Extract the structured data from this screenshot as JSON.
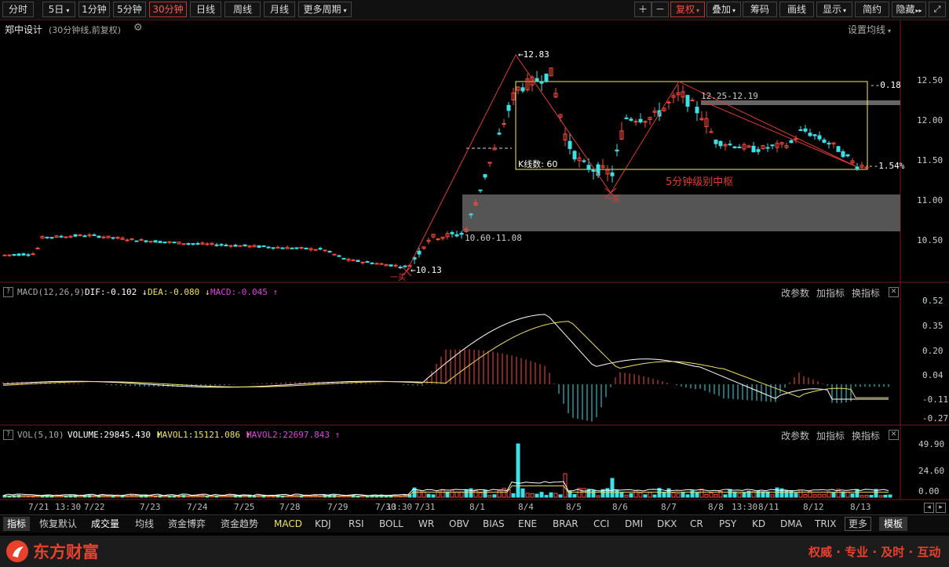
{
  "toolbar_left": [
    {
      "label": "分时",
      "active": false
    },
    {
      "label": "5日",
      "caret": true,
      "active": false
    },
    {
      "label": "1分钟",
      "active": false
    },
    {
      "label": "5分钟",
      "active": false
    },
    {
      "label": "30分钟",
      "active": true
    },
    {
      "label": "日线",
      "active": false
    },
    {
      "label": "周线",
      "active": false
    },
    {
      "label": "月线",
      "active": false
    },
    {
      "label": "更多周期",
      "caret": true,
      "active": false
    }
  ],
  "toolbar_right": [
    {
      "label": "＋"
    },
    {
      "label": "－"
    },
    {
      "label": "复权",
      "caret": true
    },
    {
      "label": "叠加",
      "caret": true
    },
    {
      "label": "筹码"
    },
    {
      "label": "画线"
    },
    {
      "label": "显示",
      "caret": true
    },
    {
      "label": "简约"
    },
    {
      "label": "隐藏",
      "arrows": "▸▸"
    }
  ],
  "stock": {
    "name": "郑中设计",
    "desc": "(30分钟线,前复权)",
    "ma_setting": "设置均线"
  },
  "price_axis": [
    "12.50",
    "12.00",
    "11.50",
    "11.00",
    "10.50"
  ],
  "annotations": {
    "high": "12.83",
    "low": "10.13",
    "zone_top_pct": "-0.18",
    "zone_bottom_pct": "-1.54%",
    "range_upper": "12.25-12.19",
    "range_lower": "10.60-11.08",
    "k_count": "K线数: 60",
    "zhongshu": "5分钟级别中枢",
    "buy_mark_1": "一买",
    "buy_mark_2": "一买"
  },
  "macd": {
    "name": "MACD(12,26,9)",
    "dif": "DIF:-0.102",
    "dea": "DEA:-0.080",
    "macd": "MACD:-0.045",
    "axis": [
      "0.52",
      "0.35",
      "0.20",
      "0.04",
      "-0.11",
      "-0.27"
    ]
  },
  "vol": {
    "name": "VOL(5,10)",
    "volume": "VOLUME:29845.430",
    "mavol1": "MAVOL1:15121.086",
    "mavol2": "MAVOL2:22697.843",
    "axis": [
      "49.90",
      "24.60",
      "0.00"
    ]
  },
  "panel_actions": [
    "改参数",
    "加指标",
    "换指标"
  ],
  "date_axis": [
    "7/21",
    "13:30",
    "7/22",
    "7/23",
    "7/24",
    "7/25",
    "7/28",
    "7/29",
    "7/30",
    "13:30",
    "7/31",
    "8/1",
    "8/4",
    "8/5",
    "8/6",
    "8/7",
    "8/8",
    "13:30",
    "8/11",
    "8/12",
    "8/13"
  ],
  "bottom_tabs": [
    "指标",
    "恢复默认",
    "成交量",
    "均线",
    "资金博弈",
    "资金趋势",
    "MACD",
    "KDJ",
    "RSI",
    "BOLL",
    "WR",
    "OBV",
    "BIAS",
    "ENE",
    "BRAR",
    "CCI",
    "DMI",
    "DKX",
    "CR",
    "PSY",
    "KD",
    "DMA",
    "TRIX",
    "更多",
    "模板"
  ],
  "footer": {
    "brand": "东方财富",
    "slogan": "权威 · 专业 · 及时 · 互动"
  },
  "colors": {
    "up": "#ff4a3c",
    "down": "#3ee0e8",
    "dif": "#ffffff",
    "dea": "#f0e060",
    "macd": "#e040e0",
    "zone": "#f0f060"
  }
}
